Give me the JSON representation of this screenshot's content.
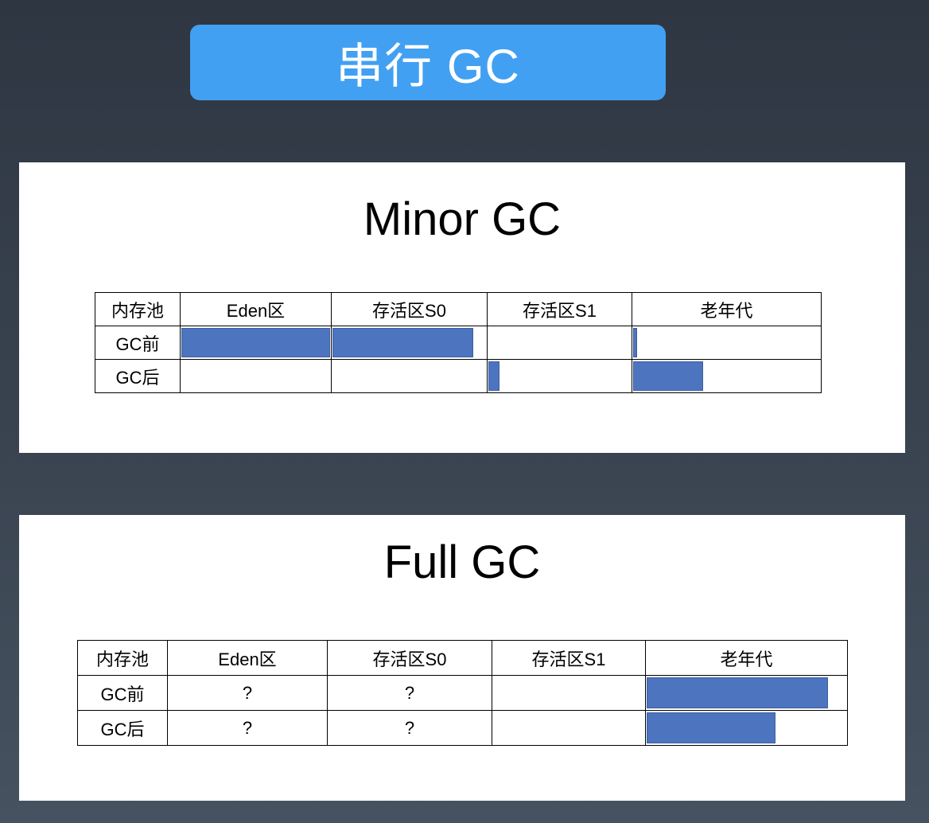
{
  "banner": {
    "title": "串行 GC"
  },
  "colors": {
    "banner": "#42a0f2",
    "bar": "#4d74bf"
  },
  "minor_gc": {
    "title": "Minor GC",
    "headers": [
      "内存池",
      "Eden区",
      "存活区S0",
      "存活区S1",
      "老年代"
    ],
    "rows": [
      {
        "label": "GC前",
        "cells": [
          "",
          "",
          "",
          ""
        ],
        "fill_percent": [
          100,
          92,
          0,
          3
        ]
      },
      {
        "label": "GC后",
        "cells": [
          "",
          "",
          "",
          ""
        ],
        "fill_percent": [
          0,
          0,
          9,
          38
        ]
      }
    ]
  },
  "full_gc": {
    "title": "Full GC",
    "headers": [
      "内存池",
      "Eden区",
      "存活区S0",
      "存活区S1",
      "老年代"
    ],
    "rows": [
      {
        "label": "GC前",
        "cells": [
          "?",
          "?",
          "",
          ""
        ],
        "fill_percent": [
          0,
          0,
          0,
          91
        ]
      },
      {
        "label": "GC后",
        "cells": [
          "?",
          "?",
          "",
          ""
        ],
        "fill_percent": [
          0,
          0,
          0,
          65
        ]
      }
    ]
  }
}
